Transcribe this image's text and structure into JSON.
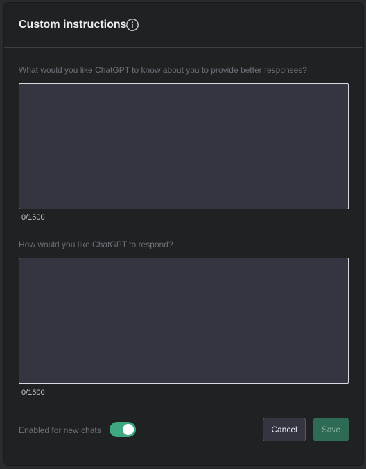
{
  "modal": {
    "title": "Custom instructions",
    "info_icon": "info-circle-icon"
  },
  "about_you": {
    "question": "What would you like ChatGPT to know about you to provide better responses?",
    "value": "",
    "counter": "0/1500"
  },
  "response_style": {
    "question": "How would you like ChatGPT to respond?",
    "value": "",
    "counter": "0/1500"
  },
  "footer": {
    "enabled_label": "Enabled for new chats",
    "enabled": true,
    "cancel_label": "Cancel",
    "save_label": "Save"
  },
  "colors": {
    "modal_bg": "#202123",
    "textarea_bg": "#343541",
    "toggle_on": "#3ea980",
    "save_bg": "#2e6b55"
  }
}
